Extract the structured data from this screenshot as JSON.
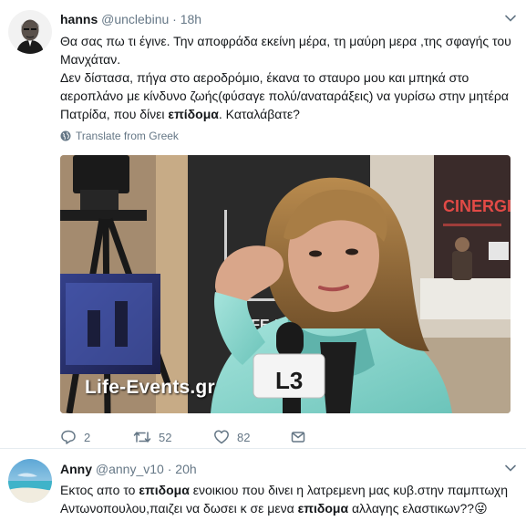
{
  "tweets": [
    {
      "display_name": "hanns",
      "handle": "@unclebinu",
      "separator": "·",
      "time": "18h",
      "paragraph1": "Θα σας πω τι έγινε. Την αποφράδα εκείνη μέρα, τη μαύρη μερα ,της σφαγής του Μανχάταν.",
      "paragraph2_a": "Δεν δίστασα, πήγα στο αεροδρόμιο, έκανα το σταυρο μου και μπηκά στο αεροπλάνο με κίνδυνο ζωής(φύσαγε πολύ/αναταράξεις) να γυρίσω στην μητέρα Πατρίδα, που δίνει ",
      "paragraph2_bold": "επίδομα",
      "paragraph2_b": ". Καταλάβατε?",
      "translate": "Translate from Greek",
      "media_caption": "Life-Events.gr",
      "mic_label": "L3",
      "banner_text": "CINERGI",
      "counts": {
        "replies": "2",
        "retweets": "52",
        "likes": "82"
      },
      "icons": {
        "reply": "reply-icon",
        "retweet": "retweet-icon",
        "like": "heart-icon",
        "dm": "envelope-icon",
        "more": "chevron-down-icon",
        "globe": "globe-icon"
      }
    },
    {
      "display_name": "Anny",
      "handle": "@anny_v10",
      "separator": "·",
      "time": "20h",
      "text_1": "Εκτος απο το ",
      "bold_1": "επιδομα",
      "text_2": " ενοικιου που δινει η λατρεμενη μας κυβ.στην παμπτωχη Αντωνοπουλου,παιζει να δωσει κ σε μενα ",
      "bold_2": "επιδομα",
      "text_3": " αλλαγης ελαστικων??",
      "emoji": "😜"
    }
  ],
  "colors": {
    "text": "#14171a",
    "secondary": "#657786",
    "border": "#e6ecf0",
    "jacket": "#8fd7cf"
  }
}
